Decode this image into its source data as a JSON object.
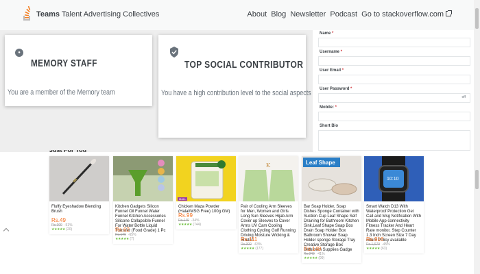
{
  "header": {
    "brand_strong": "Teams",
    "brand_rest": "Talent Advertising Collectives",
    "nav": [
      "About",
      "Blog",
      "Newsletter",
      "Podcast",
      "Go to stackoverflow.com"
    ]
  },
  "badges": [
    {
      "title": "MEMORY STAFF",
      "description": "You are a member of the Memory team",
      "icon": "badge-person-icon"
    },
    {
      "title": "TOP SOCIAL CONTRIBUTOR",
      "description": "You have a high contribution level to the social aspects",
      "icon": "checkmark-shield-icon"
    }
  ],
  "form": {
    "fields": [
      {
        "label": "Name",
        "required": true
      },
      {
        "label": "Username",
        "required": true
      },
      {
        "label": "User Email",
        "required": true
      },
      {
        "label": "User Password",
        "required": true
      },
      {
        "label": "Mobile",
        "required": true
      },
      {
        "label": "Short Bio",
        "required": false
      }
    ],
    "password_toggle": "off"
  },
  "products_section": {
    "title": "Just For You",
    "items": [
      {
        "name": "Fluffy Eyeshadow Blending Brush",
        "price": "Rs.49",
        "old_price": "Rs.100",
        "discount": "-51%",
        "rating_count": "(20)",
        "tag": ""
      },
      {
        "name": "Kitchen Gadgets Silicon Funnel Oil Funnel Water Funnel Kitchen Accessories Silicone Collapsible Funnel For Water Bottle Liquid Transfer (Food Grade) 1 Pc",
        "price": "Rs.62",
        "old_price": "Rs.176",
        "discount": "-65%",
        "rating_count": "(7)",
        "tag": ""
      },
      {
        "name": "Chicken Maza Powder (Halal/MSG Free) 100g GM)",
        "price": "Rs.99",
        "old_price": "Rs.149",
        "discount": "-34%",
        "rating_count": "(744)",
        "tag": "MALL"
      },
      {
        "name": "Pair of Cooling Arm Sleeves for Men, Women and Girls Long Sun Sleeves Hijab Arm Cover up Sleeves to Cover Arms UV Cam Cooling Clothing Cycling Golf Running Driving Moisture Wicking & Stretch",
        "price": "Rs.111",
        "old_price": "Rs.300",
        "discount": "-63%",
        "rating_count": "(177)",
        "tag": ""
      },
      {
        "name": "Bar Soap Holder, Soap Dishes Sponge Container with Suction Cup Leaf Shape Self Draining for Bathroom Kitchen Sink,Leaf Shape Soap Box Drain Soap Holder Box Bathroom Shower Soap Holder sponge Storage Tray Creative Storage Box Bathroom Supplies Gadge",
        "price": "Rs.148",
        "old_price": "Rs.249",
        "discount": "-41%",
        "rating_count": "(99)",
        "tag": ""
      },
      {
        "name": "Smart Watch D13 With Waterproof Protection Get Call and Msg Notification With Mobile App connectivity Fitness Tracker And Heart Rate monitor, Step Counter 1.3 Inch Screen Size 7 Day return Policy available",
        "price": "Rs.916",
        "old_price": "Rs.1,679",
        "discount": "-45%",
        "rating_count": "(63)",
        "tag": ""
      }
    ]
  },
  "colors": {
    "price": "#f57224",
    "stars": "#6cbf3c",
    "required": "#d1383d",
    "brand_logo": "#f48024"
  }
}
